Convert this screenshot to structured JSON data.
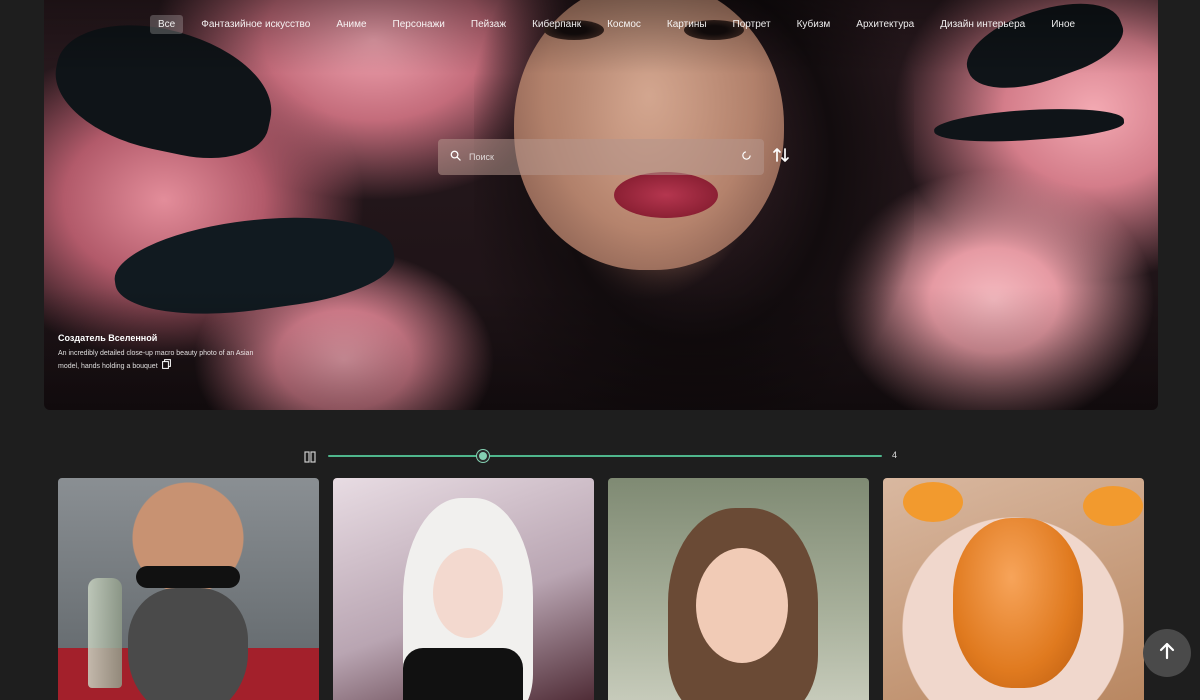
{
  "nav": {
    "items": [
      {
        "label": "Все",
        "active": true
      },
      {
        "label": "Фантазийное искусство"
      },
      {
        "label": "Аниме"
      },
      {
        "label": "Персонажи"
      },
      {
        "label": "Пейзаж"
      },
      {
        "label": "Киберпанк"
      },
      {
        "label": "Космос"
      },
      {
        "label": "Картины"
      },
      {
        "label": "Портрет"
      },
      {
        "label": "Кубизм"
      },
      {
        "label": "Архитектура"
      },
      {
        "label": "Дизайн интерьера"
      },
      {
        "label": "Иное"
      }
    ]
  },
  "search": {
    "placeholder": "Поиск",
    "value": ""
  },
  "hero": {
    "title": "Создатель Вселенной",
    "description": "An incredibly detailed close-up macro beauty photo of an Asian model, hands holding a bouquet"
  },
  "slider": {
    "value": 4,
    "value_label": "4",
    "fraction": 0.28
  },
  "cards": [
    {
      "subject": "bald bearded man with sunglasses"
    },
    {
      "subject": "white-haired anime girl"
    },
    {
      "subject": "girl with long brown hair"
    },
    {
      "subject": "orange gummy bear on plate"
    }
  ],
  "colors": {
    "accent": "#4fb68c",
    "background": "#1e1e1e"
  },
  "icons": {
    "search": "search-icon",
    "clear": "spinner-icon",
    "sort": "sort-icon",
    "grid": "grid-icon",
    "copy": "copy-icon",
    "scroll_top": "arrow-up-icon"
  }
}
